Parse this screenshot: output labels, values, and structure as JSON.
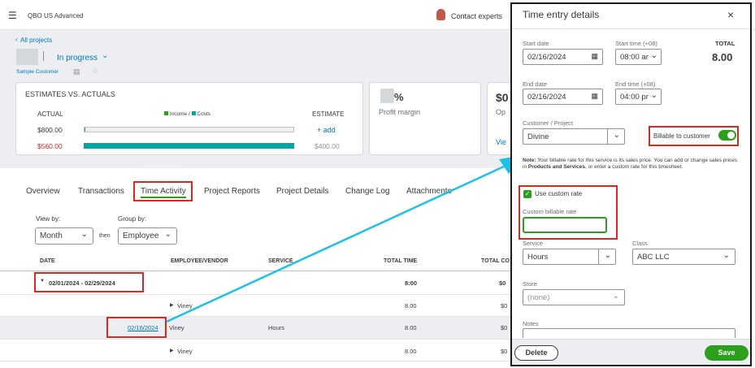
{
  "app": {
    "title": "QBO US Advanced",
    "contact": "Contact experts"
  },
  "project": {
    "back_link": "All projects",
    "status": "In progress",
    "customer": "Sample Customer"
  },
  "estimates": {
    "title": "ESTIMATES VS. ACTUALS",
    "actual_label": "ACTUAL",
    "legend_income": "Income",
    "legend_sep": "/",
    "legend_costs": "Costs",
    "estimate_label": "ESTIMATE",
    "actual_income": "$800.00",
    "actual_costs": "$560.00",
    "add_link": "+ add",
    "estimate_costs": "$400.00"
  },
  "profit": {
    "value": "%",
    "label": "Profit margin"
  },
  "card3": {
    "value": "$0",
    "label": "Op",
    "link": "Vie"
  },
  "tabs": [
    "Overview",
    "Transactions",
    "Time Activity",
    "Project Reports",
    "Project Details",
    "Change Log",
    "Attachments"
  ],
  "filters": {
    "view_by_label": "View by:",
    "view_by_value": "Month",
    "then": "then",
    "group_by_label": "Group by:",
    "group_by_value": "Employee"
  },
  "table": {
    "headers": [
      "DATE",
      "EMPLOYEE/VENDOR",
      "SERVICE",
      "TOTAL TIME",
      "TOTAL CO"
    ],
    "group": {
      "range": "02/01/2024 - 02/29/2024",
      "total_time": "8:00",
      "total_cost": "$0"
    },
    "rows": [
      {
        "date": "",
        "employee": "Viney",
        "service": "",
        "time": "8.00",
        "cost": "$0"
      },
      {
        "date": "02/16/2024",
        "employee": "Viney",
        "service": "Hours",
        "time": "8.00",
        "cost": "$0"
      },
      {
        "date": "",
        "employee": "Viney",
        "service": "",
        "time": "8.00",
        "cost": "$0"
      }
    ]
  },
  "panel": {
    "title": "Time entry details",
    "start_date_label": "Start date",
    "start_date": "02/16/2024",
    "start_time_label": "Start time (+08)",
    "start_time": "08:00 ar",
    "total_label": "TOTAL",
    "total": "8.00",
    "end_date_label": "End date",
    "end_date": "02/16/2024",
    "end_time_label": "End time (+08)",
    "end_time": "04:00 pr",
    "customer_label": "Customer / Project",
    "customer_value": "Divine",
    "billable_label": "Billable to customer",
    "note_bold": "Note:",
    "note_text": "Your billable rate for this service is its sales price. You can add or change sales prices in",
    "note_link1": "Products and Services",
    "note_text2": ", or enter a custom rate for this timesheet.",
    "custom_rate_checkbox": "Use custom rate",
    "custom_rate_label": "Custom billable rate",
    "custom_rate_value": "",
    "service_label": "Service",
    "service_value": "Hours",
    "class_label": "Class",
    "class_value": "ABC LLC",
    "store_label": "Store",
    "store_value": "(none)",
    "notes_label": "Notes",
    "delete_label": "Delete",
    "save_label": "Save"
  },
  "colors": {
    "accent": "#0077c5",
    "green": "#2ca01c",
    "red": "#d52b1e",
    "teal": "#00a6a4",
    "arrow": "#1dc1e6"
  }
}
